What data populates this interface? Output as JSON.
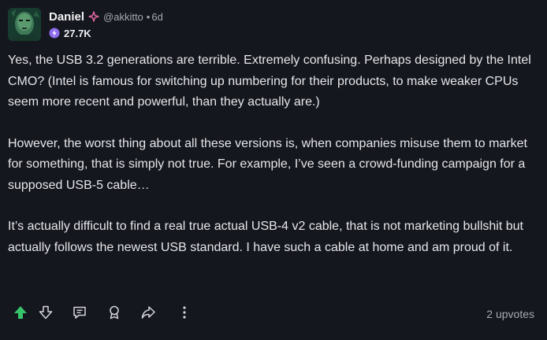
{
  "post": {
    "author": {
      "name": "Daniel",
      "handle": "@akkitto",
      "separator": "•",
      "time_ago": "6d",
      "karma": "27.7K",
      "verified_icon": "sparkle-outline-icon",
      "karma_icon": "lightning-circle-icon"
    },
    "paragraphs": [
      "Yes, the USB 3.2 generations are terrible. Extremely confusing. Perhaps designed by the Intel CMO? (Intel is famous for switching up numbering for their products, to make weaker CPUs seem more recent and powerful, than they actually are.)",
      "However, the worst thing about all these versions is, when companies misuse them to market for something, that is simply not true. For example, I’ve seen a crowd-funding campaign for a supposed USB-5 cable…",
      "It’s actually difficult to find a real true actual USB-4 v2 cable, that is not marketing bullshit but actually follows the newest USB standard. I have such a cable at home and am proud of it."
    ],
    "actions": {
      "upvote_icon": "arrow-up-icon",
      "downvote_icon": "arrow-down-outline-icon",
      "comment_icon": "speech-bubble-icon",
      "award_icon": "award-ribbon-icon",
      "share_icon": "share-arrow-icon",
      "more_icon": "vertical-ellipsis-icon",
      "upvotes_label": "2 upvotes"
    },
    "colors": {
      "background": "#15171e",
      "upvote_active": "#36c46a",
      "badge": "#e86aa8",
      "karma": "#8e6cf0",
      "muted": "#a6a8b2"
    }
  }
}
